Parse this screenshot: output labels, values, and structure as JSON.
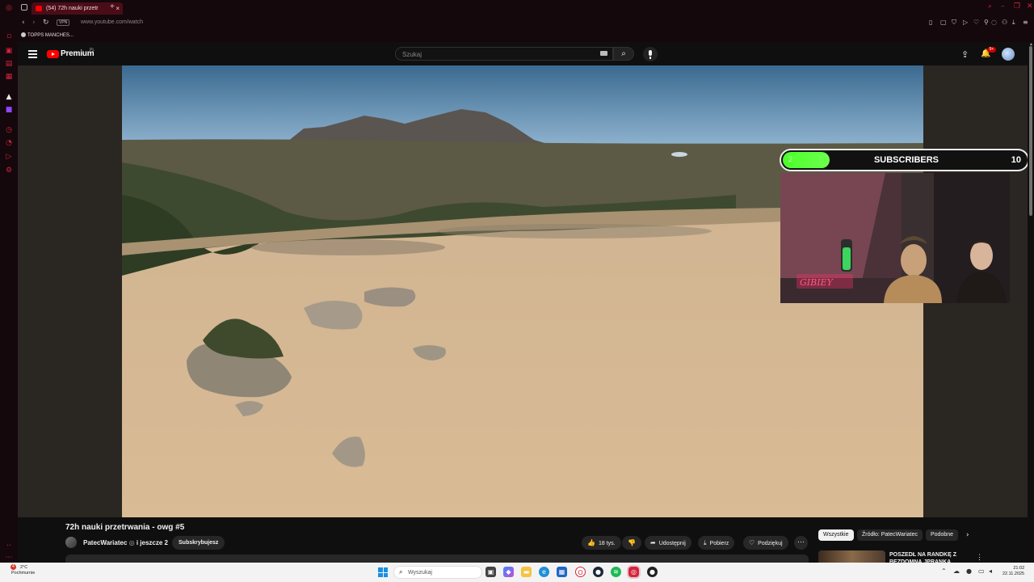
{
  "browser": {
    "tab_title": "(54) 72h nauki przetr",
    "url": "www.youtube.com/watch",
    "vpn_label": "VPN",
    "bookmark": "TOPPS MANCHES..."
  },
  "youtube": {
    "brand": "Premium",
    "country_code": "PL",
    "search_placeholder": "Szukaj",
    "notifications_badge": "9+",
    "overlay": {
      "bar_value": "2",
      "title": "SUBSCRIBERS",
      "count": "10"
    },
    "webcam_sign": "GIBIEY",
    "video_title": "72h nauki przetrwania - owg #5",
    "channel": "PatecWariatec",
    "channel_suffix": "i jeszcze 2",
    "subscribe_label": "Subskrybujesz",
    "actions": {
      "likes": "18 tys.",
      "share": "Udostępnij",
      "download": "Pobierz",
      "thanks": "Podziękuj"
    },
    "chips": [
      "Wszystkie",
      "Źródło: PatecWariatec",
      "Podobne"
    ],
    "recommended": {
      "title": "POSZEDŁ NA RANDKĘ Z BEZDOMNĄ JPRANKA"
    }
  },
  "taskbar": {
    "weather_temp": "2°C",
    "weather_desc": "Pochmurnie",
    "weather_badge": "4",
    "search_label": "Wyszukaj",
    "time": "21:02",
    "date": "22.11.2025"
  },
  "colors": {
    "opera_red": "#d4243c",
    "youtube_red": "#ff0000",
    "overlay_green": "#4cff2a"
  }
}
